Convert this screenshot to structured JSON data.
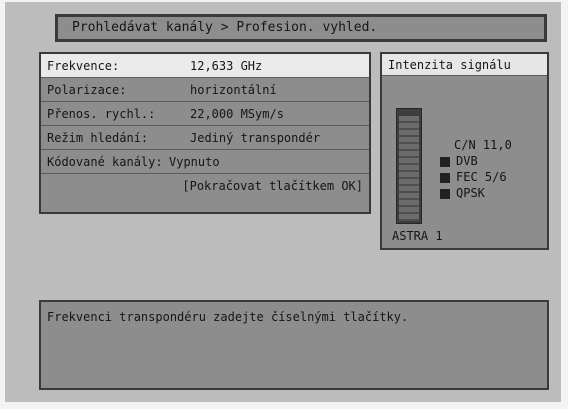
{
  "breadcrumb": "Prohledávat kanály > Profesion. vyhled.",
  "form": {
    "rows": [
      {
        "label": "Frekvence:",
        "value": "12,633  GHz"
      },
      {
        "label": "Polarizace:",
        "value": "horizontální"
      },
      {
        "label": "Přenos. rychl.:",
        "value": "22,000  MSym/s"
      },
      {
        "label": "Režim hledání:",
        "value": "Jediný transpondér"
      },
      {
        "label": "Kódované kanály:",
        "value": "Vypnuto"
      }
    ],
    "ok_hint": "[Pokračovat tlačítkem OK]"
  },
  "signal": {
    "title": "Intenzita signálu",
    "level": 0.95,
    "cn": "C/N  11,0",
    "standard": "DVB",
    "fec": "FEC  5/6",
    "modulation": "QPSK",
    "satellite": "ASTRA 1"
  },
  "help_text": "Frekvenci transpondéru zadejte číselnými tlačítky.",
  "colors": {
    "panel": "#8d8d8d",
    "background": "#bcbcbc",
    "highlight": "#eaeaea"
  }
}
